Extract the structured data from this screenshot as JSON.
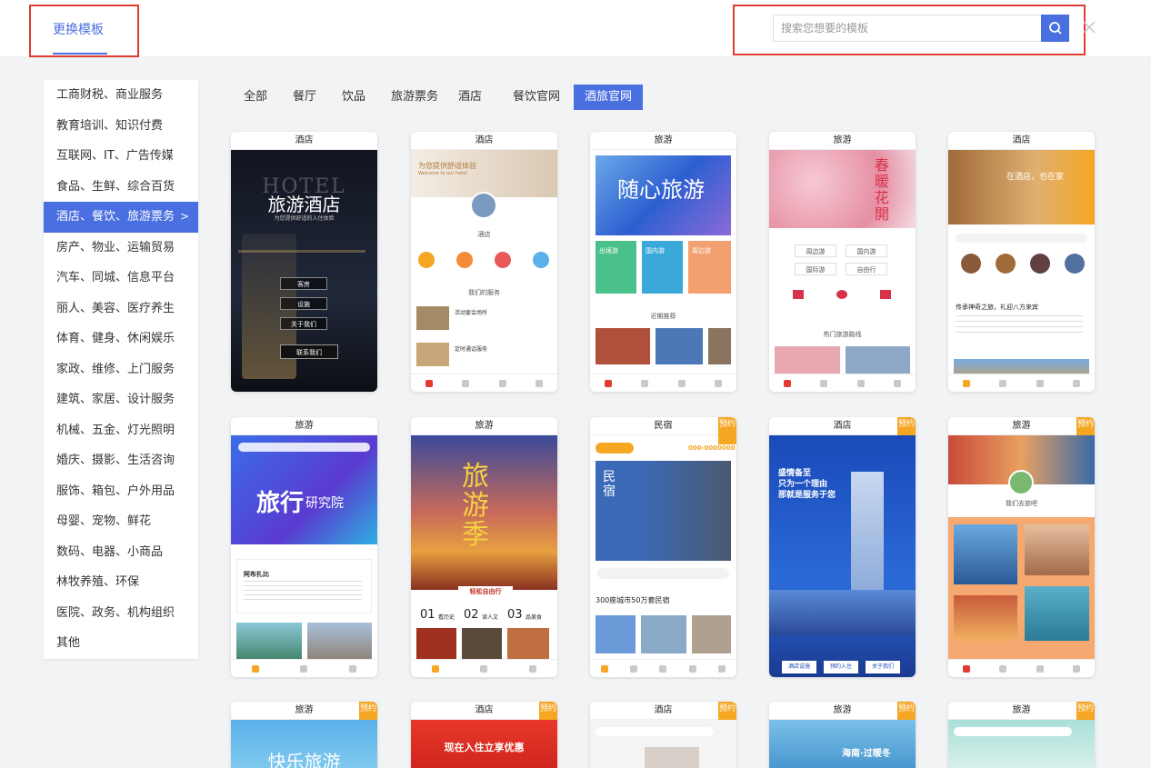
{
  "header": {
    "tab_label": "更换模板",
    "search_placeholder": "搜索您想要的模板",
    "search_icon": "search-icon",
    "close_icon": "close-icon"
  },
  "sidebar": {
    "items": [
      {
        "label": "工商财税、商业服务"
      },
      {
        "label": "教育培训、知识付费"
      },
      {
        "label": "互联网、IT、广告传媒"
      },
      {
        "label": "食品、生鲜、综合百货"
      },
      {
        "label": "酒店、餐饮、旅游票务"
      },
      {
        "label": "房产、物业、运输贸易"
      },
      {
        "label": "汽车、同城、信息平台"
      },
      {
        "label": "丽人、美容、医疗养生"
      },
      {
        "label": "体育、健身、休闲娱乐"
      },
      {
        "label": "家政、维修、上门服务"
      },
      {
        "label": "建筑、家居、设计服务"
      },
      {
        "label": "机械、五金、灯光照明"
      },
      {
        "label": "婚庆、摄影、生活咨询"
      },
      {
        "label": "服饰、箱包、户外用品"
      },
      {
        "label": "母婴、宠物、鲜花"
      },
      {
        "label": "数码、电器、小商品"
      },
      {
        "label": "林牧养殖、环保"
      },
      {
        "label": "医院、政务、机构组织"
      },
      {
        "label": "其他"
      }
    ],
    "active_index": 4,
    "chevron": ">"
  },
  "categories": [
    "全部",
    "餐厅",
    "饮品",
    "旅游票务",
    "酒店",
    "餐饮官网",
    "酒旅官网"
  ],
  "badge_text": "预约",
  "cards": {
    "r1c1": {
      "head": "酒店",
      "logo": "HOTEL",
      "title": "旅游酒店",
      "sub": "为您提供舒适的入住体验",
      "btns": [
        "客房",
        "设施",
        "关于我们",
        "联系我们"
      ]
    },
    "r1c2": {
      "head": "酒店",
      "banner": "为您提供舒适体验",
      "banner_en": "Welcome to our hotel",
      "name": "酒店",
      "section": "我们的服务",
      "item1": "活动宴会场所",
      "item2": "定时通话服务"
    },
    "r1c3": {
      "head": "旅游",
      "title": "随心旅游",
      "b1": "出境游",
      "b2": "国内游",
      "b3": "周边游",
      "section": "近期推荐"
    },
    "r1c4": {
      "head": "旅游",
      "title": "春暖花開",
      "t1": "周边游",
      "t2": "国内游",
      "t3": "国际游",
      "t4": "自由行",
      "section": "热门旅游路线"
    },
    "r1c5": {
      "head": "酒店",
      "banner": "在酒店，也在家",
      "heading": "传承神奇之旅，礼迎八方来宾"
    },
    "r2c1": {
      "head": "旅游",
      "title": "旅行",
      "title2": "研究院",
      "place": "阿布扎比"
    },
    "r2c2": {
      "head": "旅游",
      "title": "旅游季",
      "sub": "轻松自由行",
      "n1": "01",
      "l1": "看历史",
      "n2": "02",
      "l2": "读人文",
      "n3": "03",
      "l3": "品美食"
    },
    "r2c3": {
      "head": "民宿",
      "title": "民宿",
      "phone": "000-0000000",
      "stat": "300座城市50万套民宿"
    },
    "r2c4": {
      "head": "酒店",
      "line1": "盛情备至",
      "line2": "只为一个理由",
      "line3": "那就是服务于您",
      "btn1": "酒店设施",
      "btn2": "预约入住",
      "btn3": "关于我们"
    },
    "r2c5": {
      "head": "旅游",
      "name": "我们去旅吧"
    },
    "r3c1": {
      "head": "旅游",
      "title": "快乐旅游"
    },
    "r3c2": {
      "head": "酒店",
      "title": "现在入住立享优惠"
    },
    "r3c3": {
      "head": "酒店"
    },
    "r3c4": {
      "head": "旅游",
      "title": "海南·过暖冬"
    },
    "r3c5": {
      "head": "旅游"
    }
  }
}
